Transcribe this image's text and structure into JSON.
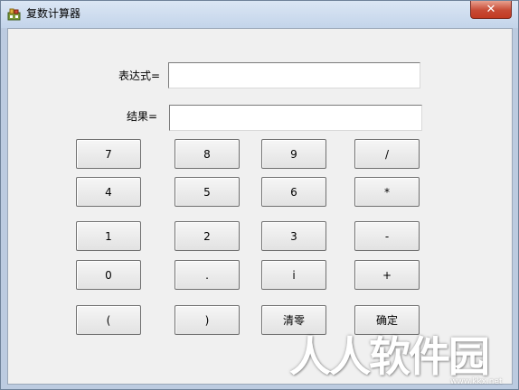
{
  "window": {
    "title": "复数计算器",
    "close_label": "✕"
  },
  "form": {
    "expression_label": "表达式=",
    "expression_value": "",
    "result_label": "结果=",
    "result_value": ""
  },
  "buttons": {
    "row1": [
      "7",
      "8",
      "9",
      "/"
    ],
    "row2": [
      "4",
      "5",
      "6",
      "*"
    ],
    "row3": [
      "1",
      "2",
      "3",
      "-"
    ],
    "row4": [
      "0",
      ".",
      "i",
      "+"
    ],
    "row5": [
      "(",
      ")",
      "清零",
      "确定"
    ]
  },
  "watermark": {
    "text": "人人软件园",
    "url": "www.kkx.net"
  }
}
